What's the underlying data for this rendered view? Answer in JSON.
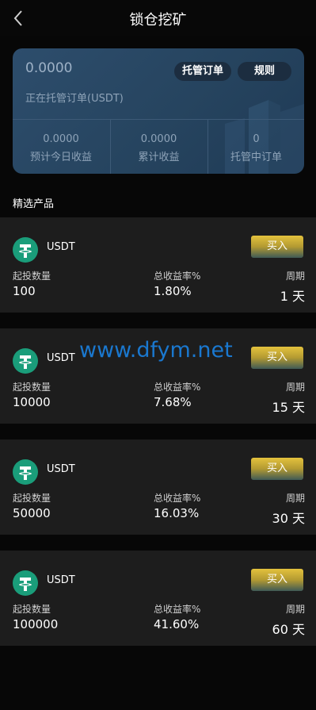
{
  "header": {
    "title": "锁仓挖矿"
  },
  "summary": {
    "amount": "0.0000",
    "label": "正在托管订单(USDT)",
    "btn_orders": "托管订单",
    "btn_rules": "规则",
    "stats": [
      {
        "value": "0.0000",
        "label": "预计今日收益"
      },
      {
        "value": "0.0000",
        "label": "累计收益"
      },
      {
        "value": "0",
        "label": "托管中订单"
      }
    ]
  },
  "section_title": "精选产品",
  "products": [
    {
      "coin": "USDT",
      "buy": "买入",
      "min_label": "起投数量",
      "min": "100",
      "rate_label": "总收益率%",
      "rate": "1.80%",
      "period_label": "周期",
      "period": "1 天"
    },
    {
      "coin": "USDT",
      "buy": "买入",
      "min_label": "起投数量",
      "min": "10000",
      "rate_label": "总收益率%",
      "rate": "7.68%",
      "period_label": "周期",
      "period": "15 天"
    },
    {
      "coin": "USDT",
      "buy": "买入",
      "min_label": "起投数量",
      "min": "50000",
      "rate_label": "总收益率%",
      "rate": "16.03%",
      "period_label": "周期",
      "period": "30 天"
    },
    {
      "coin": "USDT",
      "buy": "买入",
      "min_label": "起投数量",
      "min": "100000",
      "rate_label": "总收益率%",
      "rate": "41.60%",
      "period_label": "周期",
      "period": "60 天"
    }
  ],
  "watermark": "www.dfym.net",
  "colors": {
    "accent_gold": "#e4c23d",
    "coin_green": "#1a9d7a",
    "card_bg": "#1d1d1d"
  }
}
